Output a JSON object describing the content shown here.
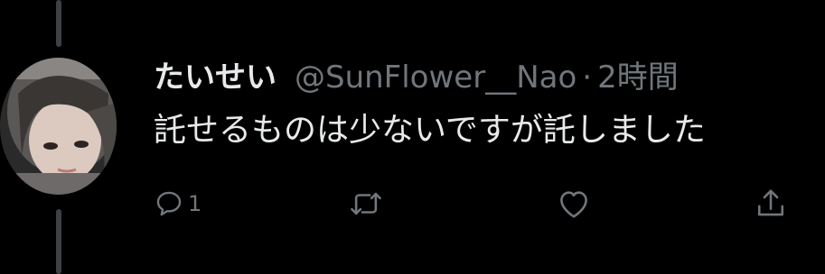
{
  "tweet": {
    "display_name": "たいせい",
    "handle": "@SunFlower__Nao",
    "separator": "·",
    "time": "2時間",
    "text": "託せるものは少ないですが託しました"
  },
  "actions": {
    "reply": {
      "icon": "reply-icon",
      "count": "1"
    },
    "retweet": {
      "icon": "retweet-icon"
    },
    "like": {
      "icon": "heart-icon"
    },
    "share": {
      "icon": "share-icon"
    }
  },
  "colors": {
    "background": "#000000",
    "primary_text": "#e7e9ea",
    "secondary_text": "#71767b",
    "thread_line": "#3d4145"
  }
}
